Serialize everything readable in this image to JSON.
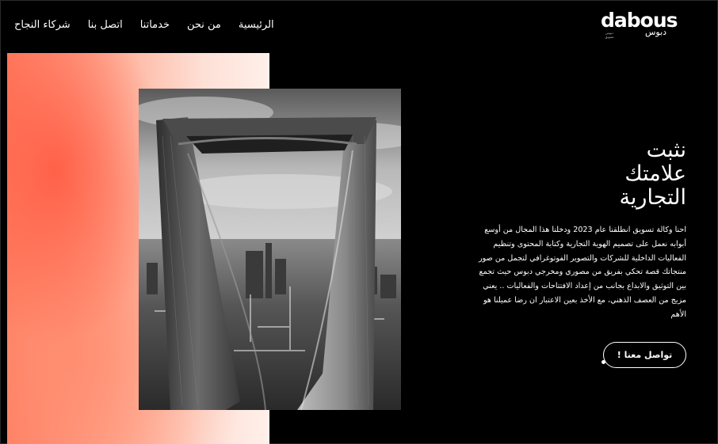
{
  "brand": {
    "logo_text": "dabous",
    "logo_arabic": "دبوس",
    "logo_tagline": "دبوس تسويق"
  },
  "nav": {
    "items": [
      {
        "label": "الرئيسية"
      },
      {
        "label": "من نحن"
      },
      {
        "label": "خدماتنا"
      },
      {
        "label": "اتصل بنا"
      },
      {
        "label": "شركاء النجاح"
      }
    ]
  },
  "hero": {
    "headline_lines": [
      "نثبت",
      "علامتك",
      "التجارية"
    ],
    "description": "احنا وكالة تسويق انطلقنا عام 2023 ودخلنا هذا المجال من أوسع أبوابه نعمل على تصميم الهوية التجارية وكتابة المحتوى وتنظيم الفعاليات الداخلية للشركات والتصوير الفوتوغرافي لتجمل من صور منتجاتك قصة تحكي بفريق من مصوري ومخرجي دبوس حيث تجمع بين التوثيق والابداع بجانب من إعداد الافتتاحات والفعاليات .. يعني مزيج من العصف الذهني، مع الأخذ بعين الاعتبار ان رضا عميلنا هو الأهم",
    "cta_label": "تواصل معنا !",
    "image_alt": "Kingdom Centre tower, Riyadh"
  },
  "colors": {
    "background": "#000000",
    "accent_gradient_start": "#ff6a4d",
    "accent_gradient_end": "#fff0ea",
    "text": "#ffffff"
  }
}
